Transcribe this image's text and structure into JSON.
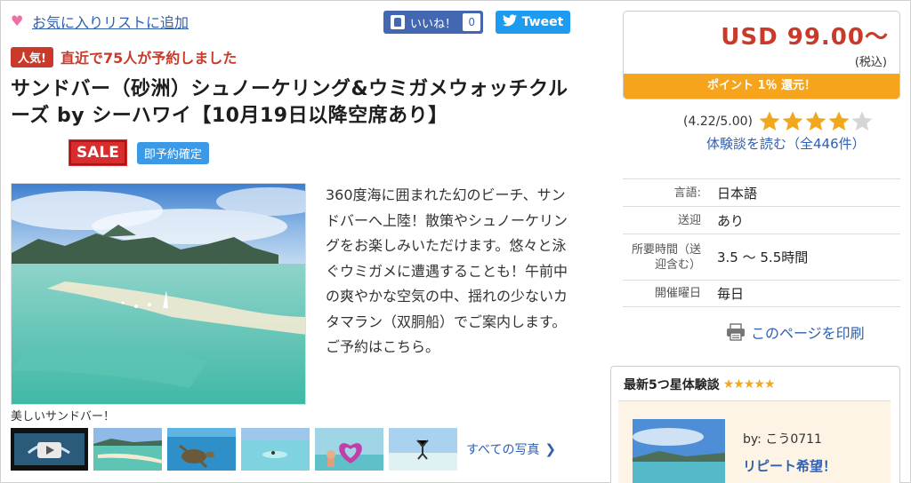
{
  "favorites": {
    "label": "お気に入りリストに追加"
  },
  "social": {
    "like_label": "いいね！",
    "like_count": "0",
    "tweet_label": "Tweet"
  },
  "popular": {
    "badge": "人気!",
    "text": "直近で75人が予約しました"
  },
  "tour": {
    "title": "サンドバー（砂洲）シュノーケリング&ウミガメウォッチクルーズ by シーハワイ【10月19日以降空席あり】",
    "sale_badge": "SALE",
    "instant_badge": "即予約確定",
    "description": "360度海に囲まれた幻のビーチ、サンドバーへ上陸！散策やシュノーケリングをお楽しみいただけます。悠々と泳ぐウミガメに遭遇することも！午前中の爽やかな空気の中、揺れの少ないカタマラン（双胴船）でご案内します。ご予約はこちら。",
    "photo_caption": "美しいサンドバー！",
    "all_photos_label": "すべての写真"
  },
  "pricing": {
    "price": "USD 99.00～",
    "tax_note": "(税込)",
    "points": "ポイント 1％ 還元！"
  },
  "rating": {
    "value_text": "(4.22/5.00)",
    "value": 4.22,
    "max": 5,
    "reviews_link": "体験談を読む（全446件）"
  },
  "info": [
    {
      "label": "言語:",
      "value": "日本語"
    },
    {
      "label": "送迎",
      "value": "あり"
    },
    {
      "label": "所要時間（送迎含む）",
      "value": "3.5 ～ 5.5時間"
    },
    {
      "label": "開催曜日",
      "value": "毎日"
    }
  ],
  "print_label": "このページを印刷",
  "latest_review": {
    "heading": "最新5つ星体験談",
    "stars": "★★★★★",
    "by": "by: こう0711",
    "title": "リピート希望！"
  },
  "colors": {
    "link": "#2f5fb1",
    "accent_red": "#c93a2b",
    "points_orange": "#f6a41c",
    "star_gold": "#f2a81c"
  }
}
